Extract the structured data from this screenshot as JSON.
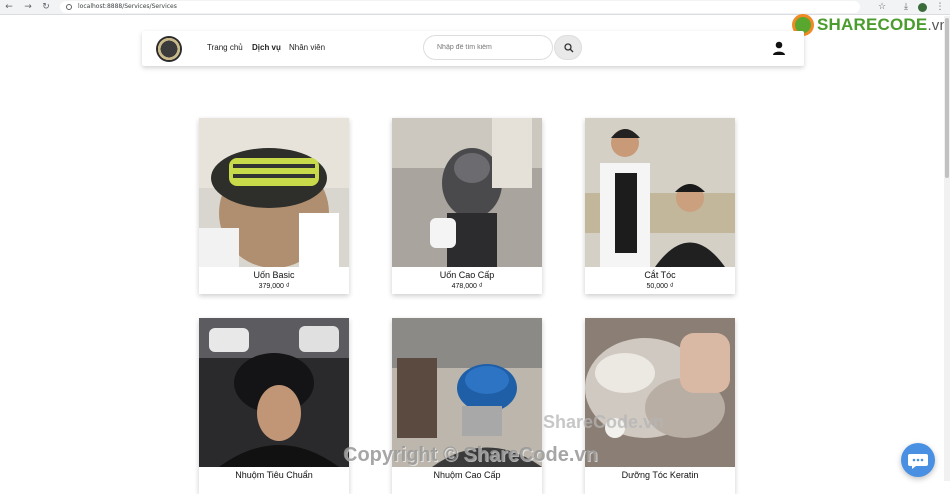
{
  "browser": {
    "url": "localhost:8888/Services/Services"
  },
  "watermark": {
    "brand": "SHARECODE",
    "brand_tld": ".vn",
    "copyright": "Copyright © ShareCode.vn",
    "site": "ShareCode.vn"
  },
  "navbar": {
    "links": [
      "Trang chủ",
      "Dịch vụ",
      "Nhân viên"
    ],
    "active_link": "Dịch vụ",
    "search_placeholder": "Nhập để tìm kiếm"
  },
  "services": [
    {
      "name": "Uốn Basic",
      "price": "379,000 ₫"
    },
    {
      "name": "Uốn Cao Cấp",
      "price": "478,000 ₫"
    },
    {
      "name": "Cắt Tóc",
      "price": "50,000 ₫"
    },
    {
      "name": "Nhuộm Tiêu Chuẩn",
      "price": ""
    },
    {
      "name": "Nhuộm Cao Cấp",
      "price": ""
    },
    {
      "name": "Dưỡng Tóc Keratin",
      "price": ""
    }
  ],
  "icons": {
    "search": "search-icon",
    "user": "user-icon",
    "chat": "chat-icon"
  }
}
